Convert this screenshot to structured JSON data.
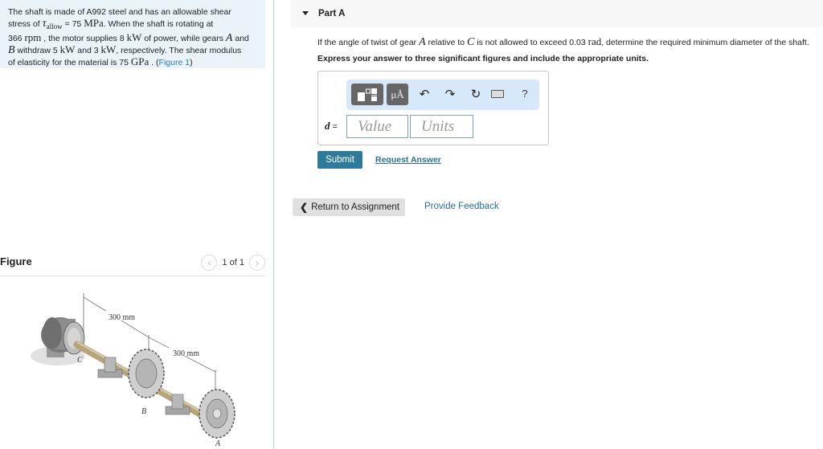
{
  "problem": {
    "line1": "The shaft is made of A992 steel and has an allowable shear",
    "line2_pre": "stress of ",
    "tau_symbol": "τ",
    "tau_sub": "allow",
    "line2_eq": " = 75 ",
    "line2_unit": "MPa",
    "line2_post": ". When the shaft is rotating at",
    "line3_rpm_val": "366 ",
    "line3_rpm_unit": "rpm",
    "line3_mid": " , the motor supplies 8 ",
    "line3_kw": "kW",
    "line3_post": " of power, while gears ",
    "gear_a": "A",
    "line3_and": " and",
    "gear_b": "B",
    "line4_mid": " withdraw 5 ",
    "line4_kw1": "kW",
    "line4_and": " and 3 ",
    "line4_kw2": "kW",
    "line4_post": ", respectively. The shear modulus",
    "line5_pre": "of elasticity for the material is 75 ",
    "line5_unit": "GPa",
    "line5_post": " . (",
    "figure_link": "Figure 1",
    "line5_close": ")"
  },
  "figure": {
    "title": "Figure",
    "pager_text": "1 of 1",
    "prev_icon": "chevron-left-icon",
    "next_icon": "chevron-right-icon",
    "dim1": "300 mm",
    "dim2": "300 mm",
    "label_a": "A",
    "label_b": "B",
    "label_c": "C"
  },
  "part": {
    "title": "Part A",
    "question_pre": "If the angle of twist of gear ",
    "question_a": "A",
    "question_mid": " relative to ",
    "question_c": "C",
    "question_mid2": " is not allowed to exceed 0.03 ",
    "question_unit": "rad",
    "question_post": ", determine the required minimum diameter of the shaft.",
    "instruction": "Express your answer to three significant figures and include the appropriate units."
  },
  "answer": {
    "variable": "d",
    "equals": " =",
    "value_placeholder": "Value",
    "units_placeholder": "Units",
    "toolbar": {
      "units_label": "μÅ",
      "undo_icon": "↶",
      "redo_icon": "↷",
      "reset_icon": "↻",
      "help_label": "?"
    }
  },
  "actions": {
    "submit": "Submit",
    "request_answer": "Request Answer",
    "return_chevron": "❮",
    "return": "Return to Assignment",
    "feedback": "Provide Feedback"
  }
}
